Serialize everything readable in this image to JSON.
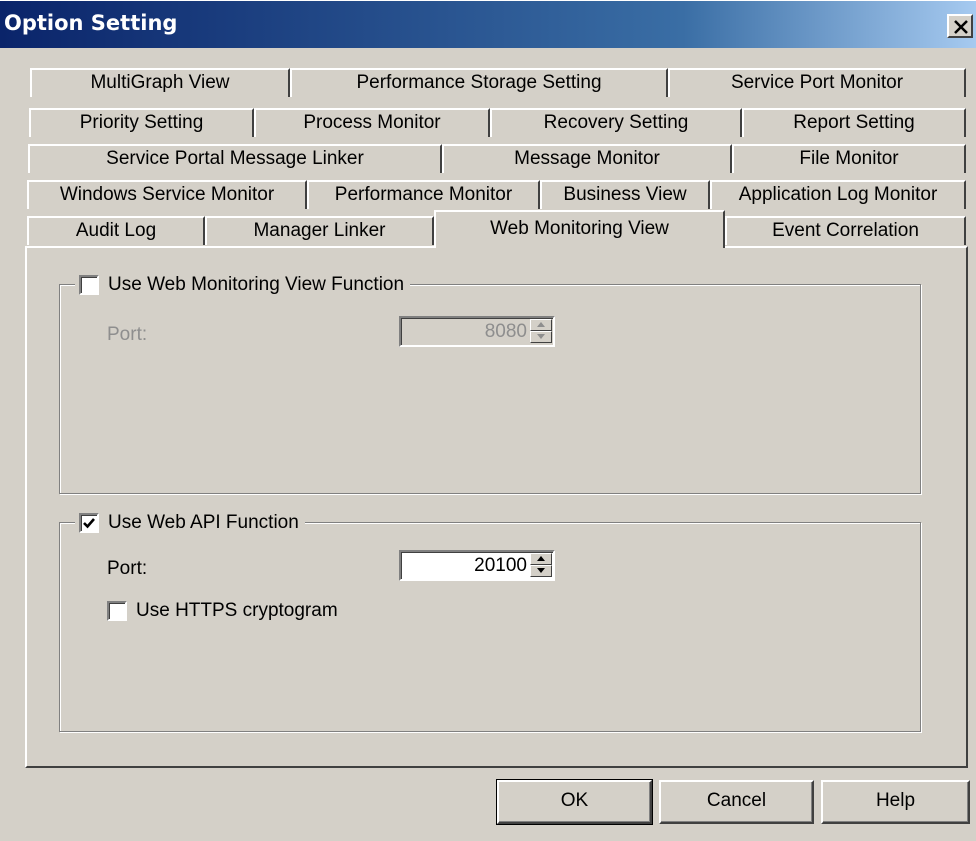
{
  "window": {
    "title": "Option Setting",
    "close_glyph": "close-icon"
  },
  "tabs": {
    "row1": [
      "MultiGraph View",
      "Performance Storage Setting",
      "Service Port Monitor"
    ],
    "row2": [
      "Priority Setting",
      "Process Monitor",
      "Recovery Setting",
      "Report Setting"
    ],
    "row3": [
      "Service Portal Message Linker",
      "Message Monitor",
      "File Monitor"
    ],
    "row4": [
      "Windows Service Monitor",
      "Performance Monitor",
      "Business View",
      "Application Log Monitor"
    ],
    "row5": [
      "Audit Log",
      "Manager Linker",
      "Web Monitoring View",
      "Event Correlation"
    ],
    "active": "Web Monitoring View"
  },
  "web_monitoring_view": {
    "enabled": false,
    "label": "Use Web Monitoring View Function",
    "port_label": "Port:",
    "port_value": "8080"
  },
  "web_api": {
    "enabled": true,
    "label": "Use Web API Function",
    "port_label": "Port:",
    "port_value": "20100",
    "https_enabled": false,
    "https_label": "Use HTTPS cryptogram"
  },
  "buttons": {
    "ok": "OK",
    "cancel": "Cancel",
    "help": "Help"
  },
  "colors": {
    "title_bar": "#0a246a",
    "face": "#d4d0c8",
    "disabled_text": "#8e8e8e"
  }
}
